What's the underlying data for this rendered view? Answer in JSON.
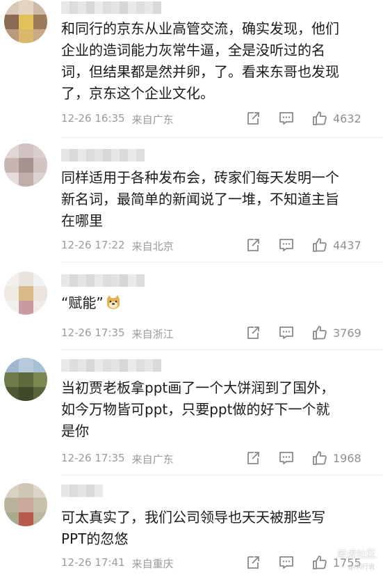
{
  "comments": [
    {
      "text": "和同行的京东从业高管交流，确实发现，他们\n企业的造词能力灰常牛逼，全是没听过的名\n词，但结果都是然并卵，了。看来东哥也发现\n了，京东这个企业文化。",
      "datetime": "12-26 16:35",
      "location": "来自广东",
      "likes": "4632"
    },
    {
      "text": "同样适用于各种发布会，砖家们每天发明一个\n新名词，最简单的新闻说了一堆，不知道主旨\n在哪里",
      "datetime": "12-26 17:22",
      "location": "来自北京",
      "likes": "4437"
    },
    {
      "text": "“赋能”",
      "emoji": "doge-emoji",
      "datetime": "12-26 17:35",
      "location": "来自浙江",
      "likes": "3769"
    },
    {
      "text": "当初贾老板拿ppt画了一个大饼润到了国外，\n如今万物皆可ppt，只要ppt做的好下一个就\n是你",
      "datetime": "12-26 17:35",
      "location": "来自广东",
      "likes": "1968"
    },
    {
      "text": "可太真实了，我们公司领导也天天被那些写\nPPT的忽悠",
      "datetime": "12-26 17:41",
      "location": "来自重庆",
      "likes": "1755"
    }
  ],
  "icons": {
    "share": "share-icon",
    "reply": "comment-icon",
    "like": "thumbs-up-icon"
  },
  "watermark": {
    "text": "老虎社区",
    "sub": "@/同行说"
  },
  "colors": {
    "meta": "#9a9a9a",
    "text": "#1a1a1a",
    "divider": "#ececec"
  }
}
